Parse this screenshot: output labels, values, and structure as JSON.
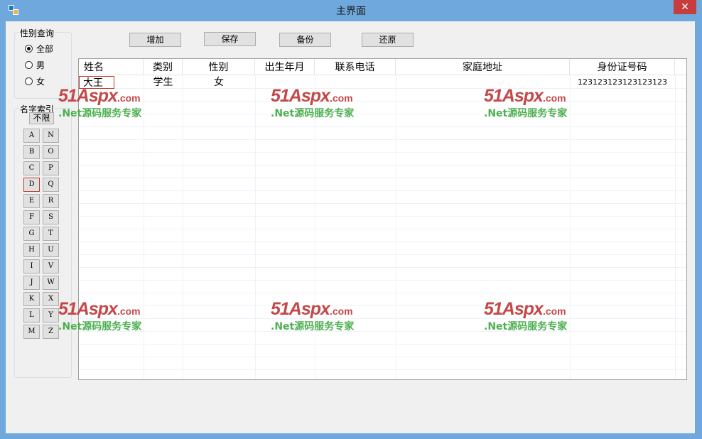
{
  "window": {
    "title": "主界面",
    "close_glyph": "✕"
  },
  "toolbar": {
    "add": "增加",
    "save": "保存",
    "backup": "备份",
    "restore": "还原"
  },
  "gender_filter": {
    "title": "性别查询",
    "options": [
      {
        "label": "全部",
        "checked": true
      },
      {
        "label": "男",
        "checked": false
      },
      {
        "label": "女",
        "checked": false
      }
    ]
  },
  "name_index": {
    "title": "名字索引",
    "unlimited": "不限",
    "letters_left": [
      "A",
      "B",
      "C",
      "D",
      "E",
      "F",
      "G",
      "H",
      "I",
      "J",
      "K",
      "L",
      "M"
    ],
    "letters_right": [
      "N",
      "O",
      "P",
      "Q",
      "R",
      "S",
      "T",
      "U",
      "V",
      "W",
      "X",
      "Y",
      "Z"
    ],
    "focused_letter": "D"
  },
  "table": {
    "columns": [
      "姓名",
      "类别",
      "性别",
      "出生年月",
      "联系电话",
      "家庭地址",
      "身份证号码"
    ],
    "rows": [
      [
        "大王",
        "学生",
        "女",
        "",
        "",
        "",
        "123123123123123123"
      ]
    ]
  },
  "watermark": {
    "logo_main": "51Aspx",
    "logo_suffix": ".com",
    "subtitle": ".Net源码服务专家"
  },
  "colors": {
    "titlebar": "#6fa8dc",
    "close": "#c73c3c",
    "watermark_red": "#c54848",
    "watermark_green": "#4caf50"
  }
}
